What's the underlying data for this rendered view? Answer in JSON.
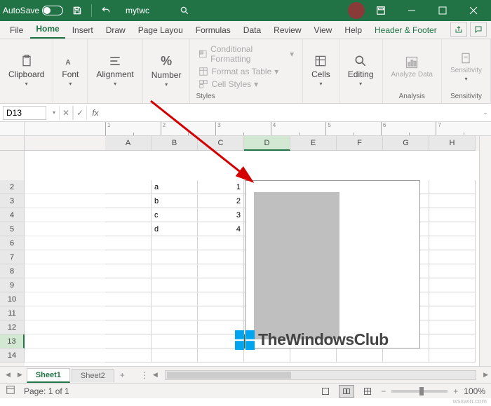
{
  "titlebar": {
    "autosave": "AutoSave",
    "docname": "mytwc"
  },
  "tabs": {
    "file": "File",
    "home": "Home",
    "insert": "Insert",
    "draw": "Draw",
    "pagelayout": "Page Layou",
    "formulas": "Formulas",
    "data": "Data",
    "review": "Review",
    "view": "View",
    "help": "Help",
    "context": "Header & Footer"
  },
  "ribbon": {
    "clipboard": "Clipboard",
    "font": "Font",
    "alignment": "Alignment",
    "number": "Number",
    "cond": "Conditional Formatting",
    "fmt_table": "Format as Table",
    "cell_styles": "Cell Styles",
    "styles": "Styles",
    "cells": "Cells",
    "editing": "Editing",
    "analyze": "Analyze Data",
    "analysis": "Analysis",
    "sensitivity": "Sensitivity",
    "sensgrp": "Sensitivity",
    "percent": "%"
  },
  "namebox": "D13",
  "fx": "fx",
  "cols": [
    "A",
    "B",
    "C",
    "D",
    "E",
    "F",
    "G",
    "H"
  ],
  "rownums": [
    "2",
    "3",
    "4",
    "5",
    "6",
    "7",
    "8",
    "9",
    "10",
    "11",
    "12",
    "13",
    "14"
  ],
  "celldata": {
    "b2": "a",
    "c2": "1",
    "b3": "b",
    "c3": "2",
    "b4": "c",
    "c4": "3",
    "b5": "d",
    "c5": "4"
  },
  "ruler": [
    "1",
    "2",
    "3",
    "4",
    "5",
    "6",
    "7"
  ],
  "watermark": "TheWindowsClub",
  "sheets": {
    "s1": "Sheet1",
    "s2": "Sheet2",
    "add": "+"
  },
  "status": {
    "page": "Page: 1 of 1",
    "zoom": "100%"
  },
  "ws": "wsxwin.com"
}
